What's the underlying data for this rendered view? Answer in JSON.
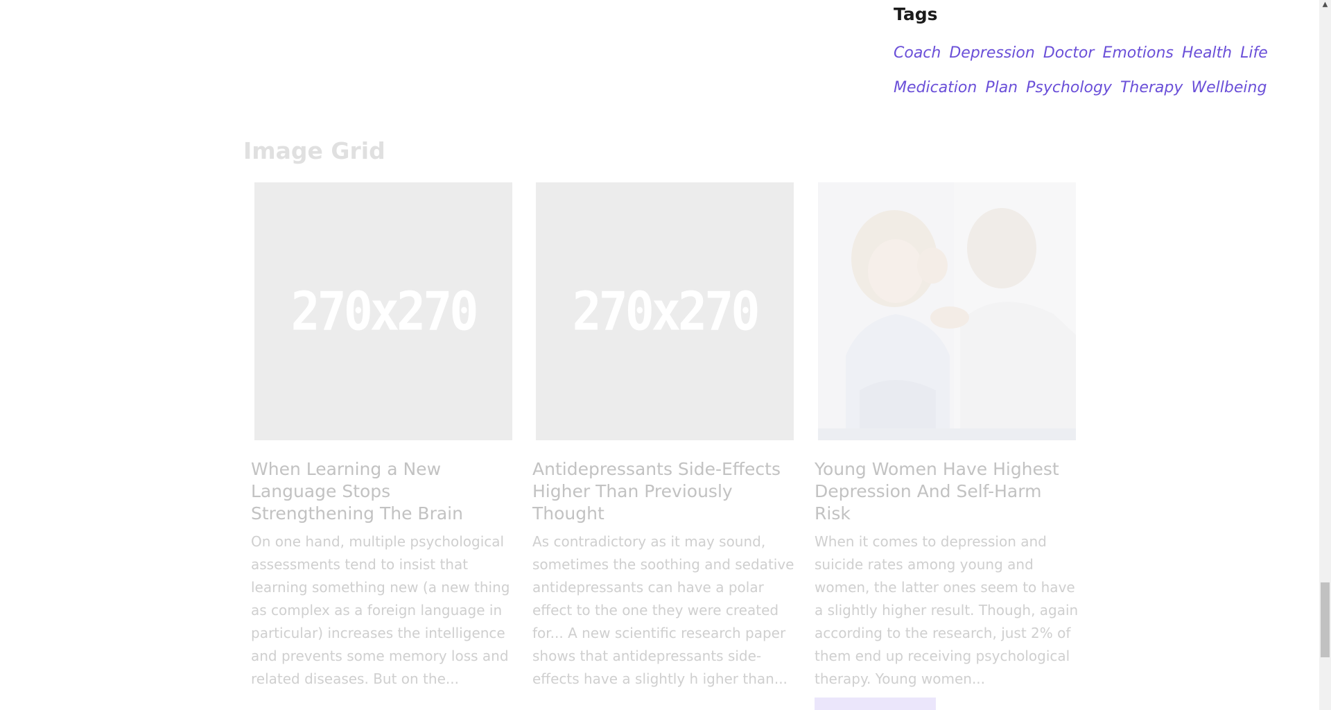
{
  "tags": {
    "title": "Tags",
    "items": [
      "Coach",
      "Depression",
      "Doctor",
      "Emotions",
      "Health",
      "Life",
      "Medication",
      "Plan",
      "Psychology",
      "Therapy",
      "Wellbeing"
    ]
  },
  "image_grid": {
    "title": "Image Grid",
    "cards": [
      {
        "placeholder": "270x270",
        "title": "When Learning a New Language Stops Strengthening The Brain",
        "excerpt": "   On one hand, multiple psychological assessments tend to insist that learning something new (a new thing as complex as a foreign language in particular) increases the intelligence and prevents some memory loss and related diseases. But on the..."
      },
      {
        "placeholder": "270x270",
        "title": "Antidepressants Side-Effects Higher Than Previously Thought",
        "excerpt": "  As contradictory as it may sound, sometimes the soothing and sedative antidepressants can have a polar effect to the one they were created for... A new scientific research paper shows that antidepressants side-effects have a slightly h igher than..."
      },
      {
        "placeholder": "",
        "title": "Young Women Have Highest Depression And Self-Harm Risk",
        "excerpt": "  When it comes to depression and suicide rates among young  and women, the latter ones seem to have a slightly higher result. Though, again according to the research, just 2% of them end up receiving psychological therapy.  Young women..."
      }
    ]
  },
  "colors": {
    "tag_link": "#6a4fd8",
    "faded_text": "#c2c2c2",
    "button_bg": "#ebe6fb"
  },
  "scrollbar": {
    "up_arrow_icon": "arrow-up-icon",
    "position_fraction": 0.9
  }
}
